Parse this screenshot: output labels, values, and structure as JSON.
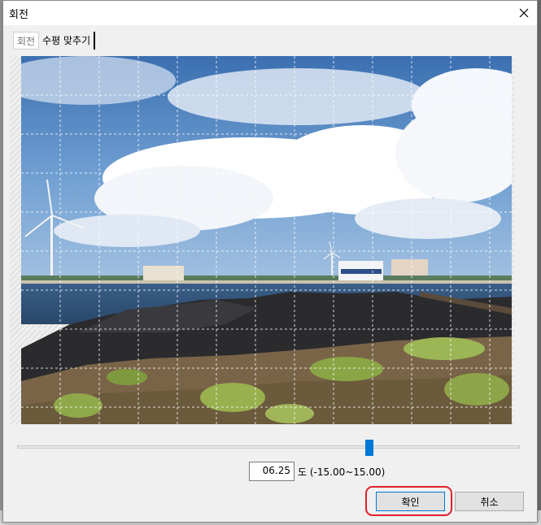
{
  "dialog": {
    "title": "회전",
    "close_icon": "close-icon"
  },
  "tabs": [
    {
      "label": "회전",
      "active": false
    },
    {
      "label": "수평 맞추기",
      "active": true
    }
  ],
  "image": {
    "description_icon": "photo-preview",
    "grid": true
  },
  "rotation": {
    "value": "06.25",
    "unit_label": "도 (-15.00~15.00)",
    "min": -15.0,
    "max": 15.0,
    "current": 6.25
  },
  "buttons": {
    "ok_label": "확인",
    "cancel_label": "취소"
  },
  "colors": {
    "accent": "#0078d7",
    "highlight": "#e0202a"
  }
}
